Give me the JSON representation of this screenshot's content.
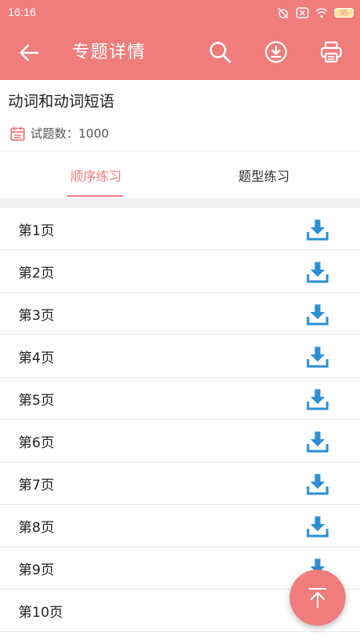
{
  "status_bar": {
    "time": "16:16",
    "battery": "95"
  },
  "app_bar": {
    "title": "专题详情"
  },
  "topic": {
    "title": "动词和动词短语",
    "count_label": "试题数：1000"
  },
  "tabs": [
    {
      "label": "顺序练习",
      "selected": true
    },
    {
      "label": "题型练习",
      "selected": false
    }
  ],
  "pages": [
    {
      "label": "第1页"
    },
    {
      "label": "第2页"
    },
    {
      "label": "第3页"
    },
    {
      "label": "第4页"
    },
    {
      "label": "第5页"
    },
    {
      "label": "第6页"
    },
    {
      "label": "第7页"
    },
    {
      "label": "第8页"
    },
    {
      "label": "第9页"
    },
    {
      "label": "第10页"
    }
  ],
  "icons": {
    "back": "arrow-left-icon",
    "search": "search-icon",
    "download": "download-circle-icon",
    "print": "printer-icon",
    "page_download": "download-icon",
    "calendar": "calendar-icon",
    "scroll_top": "arrow-up-icon"
  },
  "colors": {
    "accent": "#f07c7c",
    "download_blue": "#2b8fd6"
  }
}
